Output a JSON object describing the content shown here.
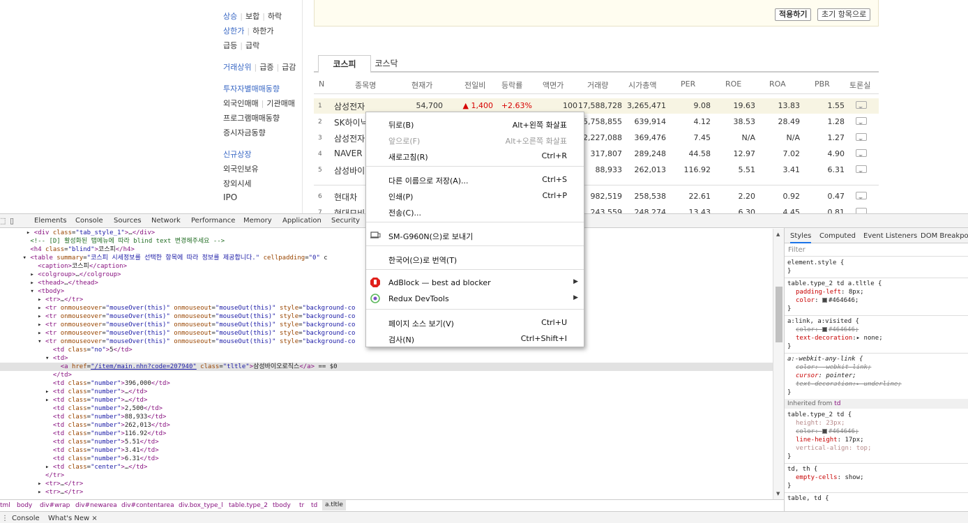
{
  "left_nav": {
    "row1": [
      "상승",
      "보합",
      "하락"
    ],
    "row2": [
      "상한가",
      "하한가"
    ],
    "row3": [
      "급등",
      "급락"
    ],
    "row4": [
      "거래상위",
      "급증",
      "급감"
    ],
    "row5": "투자자별매매동향",
    "row6": [
      "외국인매매",
      "기관매매"
    ],
    "row7": "프로그램매매동향",
    "row8": "증시자금동향",
    "row9": "신규상장",
    "row10": "외국인보유",
    "row11": "장외시세",
    "row12": "IPO"
  },
  "top_box": {
    "apply_label": "적용하기",
    "reset_label": "초기 항목으로"
  },
  "market_tabs": [
    "코스피",
    "코스닥"
  ],
  "table": {
    "headers": [
      "N",
      "종목명",
      "현재가",
      "전일비",
      "등락률",
      "액면가",
      "거래량",
      "시가총액",
      "PER",
      "ROE",
      "ROA",
      "PBR",
      "토론실"
    ],
    "rows": [
      {
        "no": "1",
        "name": "삼성전자",
        "price": "54,700",
        "change": "▲ 1,400",
        "rate": "+2.63%",
        "face": "100",
        "volume": "17,588,728",
        "cap": "3,265,471",
        "per": "9.08",
        "roe": "19.63",
        "roa": "13.83",
        "pbr": "1.55"
      },
      {
        "no": "2",
        "name": "SK하이닉",
        "volume": "5,758,855",
        "cap": "639,914",
        "per": "4.12",
        "roe": "38.53",
        "roa": "28.49",
        "pbr": "1.28"
      },
      {
        "no": "3",
        "name": "삼성전자",
        "volume": "2,227,088",
        "cap": "369,476",
        "per": "7.45",
        "roe": "N/A",
        "roa": "N/A",
        "pbr": "1.27"
      },
      {
        "no": "4",
        "name": "NAVER",
        "volume": "317,807",
        "cap": "289,248",
        "per": "44.58",
        "roe": "12.97",
        "roa": "7.02",
        "pbr": "4.90"
      },
      {
        "no": "5",
        "name": "삼성바이",
        "volume": "88,933",
        "cap": "262,013",
        "per": "116.92",
        "roe": "5.51",
        "roa": "3.41",
        "pbr": "6.31"
      },
      {
        "no": "6",
        "name": "현대차",
        "volume": "982,519",
        "cap": "258,538",
        "per": "22.61",
        "roe": "2.20",
        "roa": "0.92",
        "pbr": "0.47"
      },
      {
        "no": "7",
        "name": "현대모비",
        "volume": "243,559",
        "cap": "248,274",
        "per": "13.43",
        "roe": "6.30",
        "roa": "4.45",
        "pbr": "0.81"
      }
    ]
  },
  "devtools": {
    "tabs": [
      "Elements",
      "Console",
      "Sources",
      "Network",
      "Performance",
      "Memory",
      "Application",
      "Security"
    ],
    "styles_tabs": [
      "Styles",
      "Computed",
      "Event Listeners",
      "DOM Breakpoints"
    ],
    "filter_placeholder": "Filter",
    "breadcrumb": [
      "tml",
      "body",
      "div#wrap",
      "div#newarea",
      "div#contentarea",
      "div.box_type_l",
      "table.type_2",
      "tbody",
      "tr",
      "td",
      "a.tltle"
    ],
    "drawer_tabs": [
      "Console",
      "What's New ×"
    ]
  },
  "context_menu": {
    "items": [
      {
        "label": "뒤로(B)",
        "shortcut": "Alt+왼쪽 화살표"
      },
      {
        "label": "앞으로(F)",
        "shortcut": "Alt+오른쪽 화살표"
      },
      {
        "label": "새로고침(R)",
        "shortcut": "Ctrl+R"
      },
      {
        "label": "다른 이름으로 저장(A)...",
        "shortcut": "Ctrl+S"
      },
      {
        "label": "인쇄(P)",
        "shortcut": "Ctrl+P"
      },
      {
        "label": "전송(C)...",
        "shortcut": ""
      },
      {
        "label": "SM-G960N(으)로 보내기",
        "shortcut": ""
      },
      {
        "label": "한국어(으)로 번역(T)",
        "shortcut": ""
      },
      {
        "label": "AdBlock — best ad blocker",
        "shortcut": ""
      },
      {
        "label": "Redux DevTools",
        "shortcut": ""
      },
      {
        "label": "페이지 소스 보기(V)",
        "shortcut": "Ctrl+U"
      },
      {
        "label": "검사(N)",
        "shortcut": "Ctrl+Shift+I"
      }
    ]
  },
  "colors": {
    "accent_blue": "#3867c4",
    "up_red": "#d60000",
    "highlight": "#f7f4e3",
    "tag": "#881280",
    "attr": "#994500",
    "value": "#1a1aa6"
  }
}
